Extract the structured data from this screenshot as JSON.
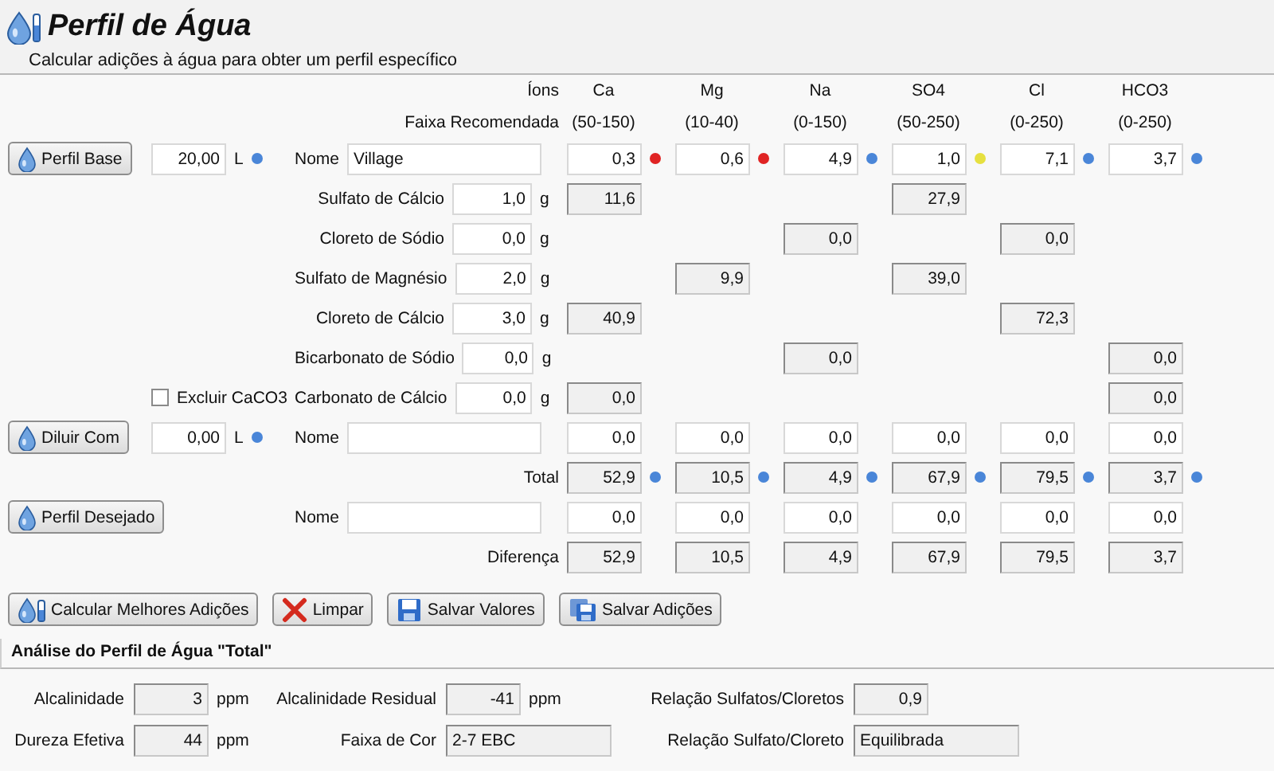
{
  "header": {
    "title": "Perfil de Água",
    "subtitle": "Calcular adições à água para obter um perfil específico"
  },
  "ions_label": "Íons",
  "range_label": "Faixa Recomendada",
  "ions": [
    {
      "name": "Ca",
      "range": "(50-150)"
    },
    {
      "name": "Mg",
      "range": "(10-40)"
    },
    {
      "name": "Na",
      "range": "(0-150)"
    },
    {
      "name": "SO4",
      "range": "(50-250)"
    },
    {
      "name": "Cl",
      "range": "(0-250)"
    },
    {
      "name": "HCO3",
      "range": "(0-250)"
    }
  ],
  "base": {
    "button": "Perfil Base",
    "volume": {
      "value": "20,00",
      "color": "#4a86d8"
    },
    "unit": "L",
    "name_label": "Nome",
    "name": "Village",
    "values": [
      {
        "value": "0,3",
        "color": "#e02424"
      },
      {
        "value": "0,6",
        "color": "#e02424"
      },
      {
        "value": "4,9",
        "color": "#4a86d8"
      },
      {
        "value": "1,0",
        "color": "#e6e040"
      },
      {
        "value": "7,1",
        "color": "#4a86d8"
      },
      {
        "value": "3,7",
        "color": "#4a86d8"
      }
    ]
  },
  "salts": [
    {
      "name": "Sulfato de Cálcio",
      "amount": "1,0",
      "unit": "g",
      "contributions": [
        {
          "kind": "value",
          "value": "11,6"
        },
        {
          "kind": "empty"
        },
        {
          "kind": "empty"
        },
        {
          "kind": "value",
          "value": "27,9"
        },
        {
          "kind": "empty"
        },
        {
          "kind": "empty"
        }
      ]
    },
    {
      "name": "Cloreto de Sódio",
      "amount": "0,0",
      "unit": "g",
      "contributions": [
        {
          "kind": "empty"
        },
        {
          "kind": "empty"
        },
        {
          "kind": "value",
          "value": "0,0"
        },
        {
          "kind": "empty"
        },
        {
          "kind": "value",
          "value": "0,0"
        },
        {
          "kind": "empty"
        }
      ]
    },
    {
      "name": "Sulfato de Magnésio",
      "amount": "2,0",
      "unit": "g",
      "contributions": [
        {
          "kind": "empty"
        },
        {
          "kind": "value",
          "value": "9,9"
        },
        {
          "kind": "empty"
        },
        {
          "kind": "value",
          "value": "39,0"
        },
        {
          "kind": "empty"
        },
        {
          "kind": "empty"
        }
      ]
    },
    {
      "name": "Cloreto de Cálcio",
      "amount": "3,0",
      "unit": "g",
      "contributions": [
        {
          "kind": "value",
          "value": "40,9"
        },
        {
          "kind": "empty"
        },
        {
          "kind": "empty"
        },
        {
          "kind": "empty"
        },
        {
          "kind": "value",
          "value": "72,3"
        },
        {
          "kind": "empty"
        }
      ]
    },
    {
      "name": "Bicarbonato de Sódio",
      "amount": "0,0",
      "unit": "g",
      "contributions": [
        {
          "kind": "empty"
        },
        {
          "kind": "empty"
        },
        {
          "kind": "value",
          "value": "0,0"
        },
        {
          "kind": "empty"
        },
        {
          "kind": "empty"
        },
        {
          "kind": "value",
          "value": "0,0"
        }
      ]
    },
    {
      "name": "Carbonato de Cálcio",
      "amount": "0,0",
      "unit": "g",
      "contributions": [
        {
          "kind": "value",
          "value": "0,0"
        },
        {
          "kind": "empty"
        },
        {
          "kind": "empty"
        },
        {
          "kind": "empty"
        },
        {
          "kind": "empty"
        },
        {
          "kind": "value",
          "value": "0,0"
        }
      ],
      "option": {
        "label": "Excluir CaCO3",
        "checked": false
      }
    }
  ],
  "dilute": {
    "button": "Diluir Com",
    "volume": {
      "value": "0,00",
      "color": "#4a86d8"
    },
    "unit": "L",
    "name_label": "Nome",
    "values": [
      "0,0",
      "0,0",
      "0,0",
      "0,0",
      "0,0",
      "0,0"
    ]
  },
  "total": {
    "label": "Total",
    "values": [
      {
        "value": "52,9",
        "color": "#4a86d8"
      },
      {
        "value": "10,5",
        "color": "#4a86d8"
      },
      {
        "value": "4,9",
        "color": "#4a86d8"
      },
      {
        "value": "67,9",
        "color": "#4a86d8"
      },
      {
        "value": "79,5",
        "color": "#4a86d8"
      },
      {
        "value": "3,7",
        "color": "#4a86d8"
      }
    ]
  },
  "target": {
    "button": "Perfil Desejado",
    "name_label": "Nome",
    "values": [
      "0,0",
      "0,0",
      "0,0",
      "0,0",
      "0,0",
      "0,0"
    ]
  },
  "difference": {
    "label": "Diferença",
    "values": [
      "52,9",
      "10,5",
      "4,9",
      "67,9",
      "79,5",
      "3,7"
    ]
  },
  "actions": [
    {
      "label": "Calcular Melhores Adições",
      "kind": "calc"
    },
    {
      "label": "Limpar",
      "kind": "clear"
    },
    {
      "label": "Salvar Valores",
      "kind": "save"
    },
    {
      "label": "Salvar Adições",
      "kind": "saveall"
    }
  ],
  "analysis": {
    "title": "Análise do Perfil de Água \"Total\"",
    "rows": [
      [
        {
          "label": "Alcalinidade",
          "value": "3",
          "unit": "ppm"
        },
        {
          "label": "Alcalinidade Residual",
          "value": "-41",
          "unit": "ppm"
        },
        {
          "label": "Relação Sulfatos/Cloretos",
          "value": "0,9"
        }
      ],
      [
        {
          "label": "Dureza Efetiva",
          "value": "44",
          "unit": "ppm"
        },
        {
          "label": "Faixa de Cor",
          "value": "2-7 EBC",
          "kind": "text"
        },
        {
          "label": "Relação Sulfato/Cloreto",
          "value": "Equilibrada",
          "kind": "text"
        }
      ]
    ]
  }
}
